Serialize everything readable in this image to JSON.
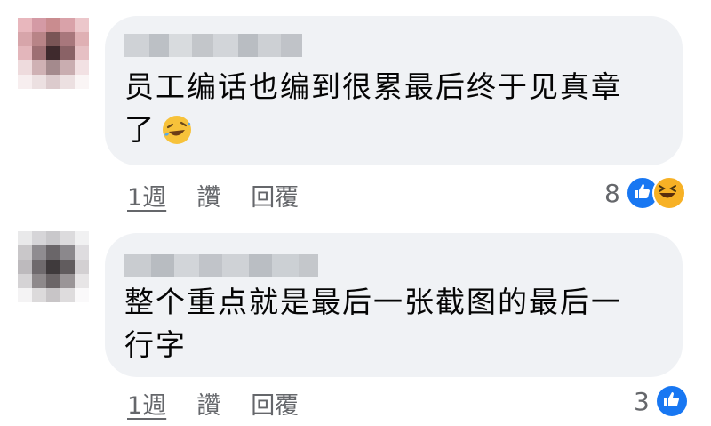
{
  "comments": [
    {
      "text_line1": "员工编话也编到很累最后终于见真章",
      "text_line2": "了",
      "emoji": "🤣",
      "time": "1週",
      "like_label": "讚",
      "reply_label": "回覆",
      "reaction_count": "8",
      "reactions": [
        "like-icon",
        "haha-icon"
      ]
    },
    {
      "text_line1": "整个重点就是最后一张截图的最后一",
      "text_line2": "行字",
      "time": "1週",
      "like_label": "讚",
      "reply_label": "回覆",
      "reaction_count": "3",
      "reactions": [
        "like-icon"
      ]
    }
  ],
  "colors": {
    "bubble": "#f0f2f5",
    "meta_text": "#65676b",
    "like_blue": "#1877f2",
    "haha_yellow": "#f7b125"
  }
}
